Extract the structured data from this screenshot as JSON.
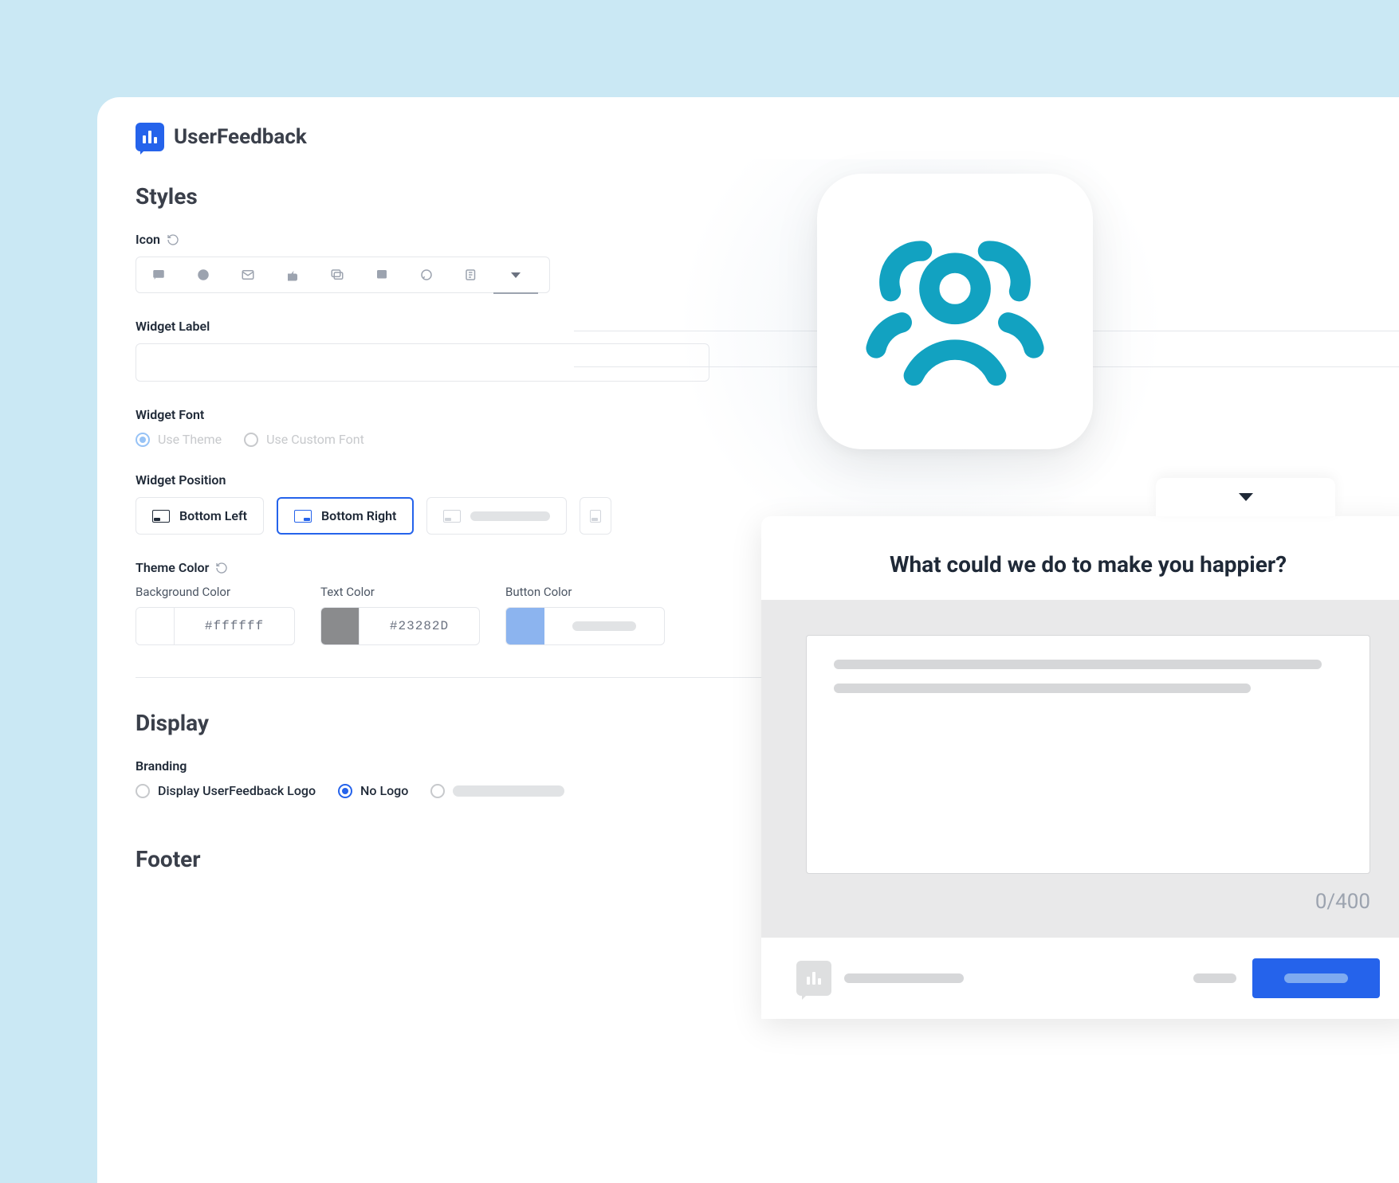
{
  "brand": {
    "name": "UserFeedback"
  },
  "sections": {
    "styles": "Styles",
    "display": "Display",
    "footer": "Footer"
  },
  "styles": {
    "icon_label": "Icon",
    "widget_label_label": "Widget Label",
    "widget_label_value": "",
    "widget_font_label": "Widget Font",
    "font_options": {
      "use_theme": "Use Theme",
      "use_custom": "Use Custom Font"
    },
    "widget_position_label": "Widget Position",
    "positions": {
      "bottom_left": "Bottom Left",
      "bottom_right": "Bottom Right"
    },
    "theme_color_label": "Theme Color",
    "colors": {
      "background_label": "Background Color",
      "background_value": "#ffffff",
      "text_label": "Text Color",
      "text_value": "#23282D",
      "button_label": "Button Color",
      "button_swatch": "#8cb4ef"
    }
  },
  "display": {
    "branding_label": "Branding",
    "branding_options": {
      "display_logo": "Display UserFeedback Logo",
      "no_logo": "No Logo"
    }
  },
  "preview": {
    "question": "What could we do to make you happier?",
    "char_count": "0/400"
  }
}
